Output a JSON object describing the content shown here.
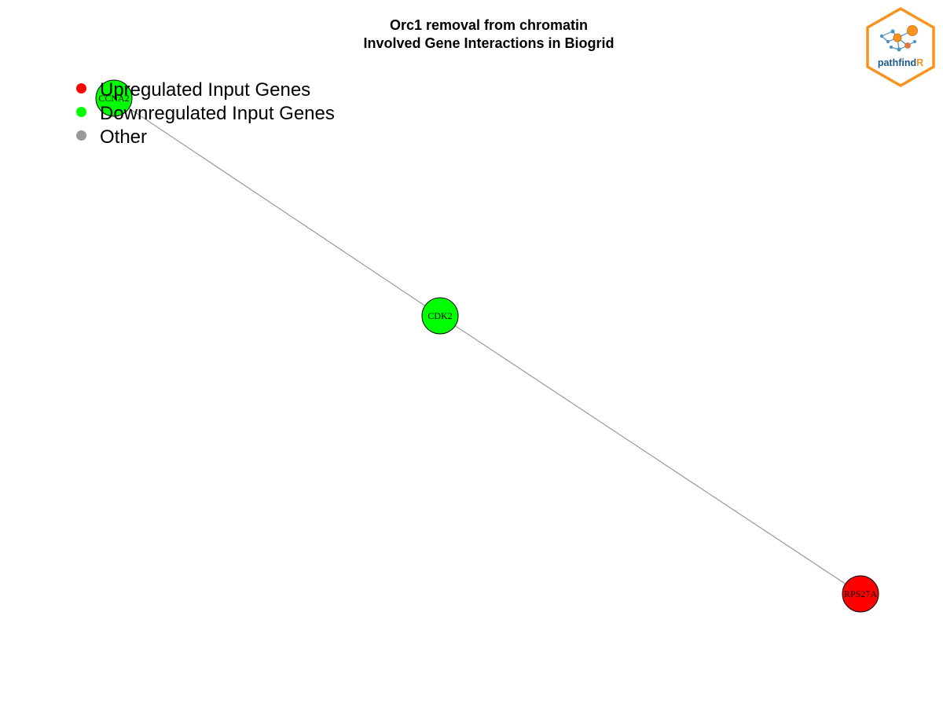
{
  "title": {
    "line1": "Orc1 removal from chromatin",
    "line2": "Involved Gene Interactions in Biogrid"
  },
  "legend": [
    {
      "label": "Upregulated Input Genes",
      "color": "#ff0000"
    },
    {
      "label": "Downregulated Input Genes",
      "color": "#00ff00"
    },
    {
      "label": "Other",
      "color": "#999999"
    }
  ],
  "network": {
    "nodes": [
      {
        "id": "CCNA2",
        "label": "CCNA2",
        "color": "#00ff00"
      },
      {
        "id": "CDK2",
        "label": "CDK2",
        "color": "#00ff00"
      },
      {
        "id": "RPS27A",
        "label": "RPS27A",
        "color": "#ff0000"
      }
    ],
    "edges": [
      {
        "source": "CCNA2",
        "target": "CDK2"
      },
      {
        "source": "CDK2",
        "target": "RPS27A"
      }
    ],
    "edge_color": "#999999"
  },
  "logo": {
    "text_main": "pathfind",
    "text_accent": "R",
    "accent_color": "#f7931e",
    "text_color": "#1a5a8a"
  }
}
